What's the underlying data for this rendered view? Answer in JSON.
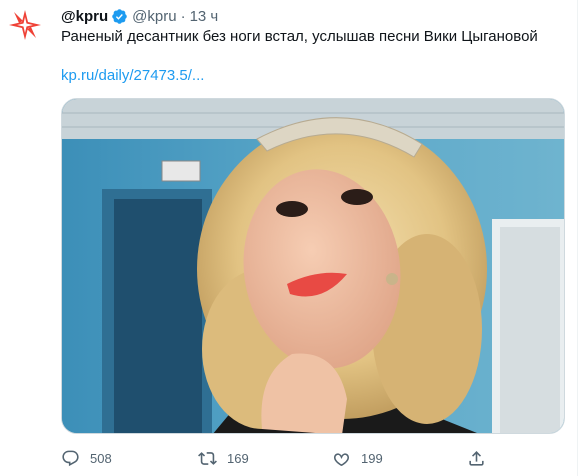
{
  "tweet": {
    "display_name": "@kpru",
    "handle": "@kpru",
    "separator": "·",
    "time": "13 ч",
    "text": "Раненый десантник без ноги встал, услышав песни Вики Цыгановой",
    "link": "kp.ru/daily/27473.5/..."
  },
  "actions": {
    "reply_count": "508",
    "retweet_count": "169",
    "like_count": "199"
  },
  "colors": {
    "brand": "#ef4136",
    "verified": "#1d9bf0",
    "link": "#1d9bf0",
    "muted": "#536471"
  },
  "icons": {
    "avatar": "kp-logo-icon",
    "verified": "verified-badge-icon",
    "reply": "reply-icon",
    "retweet": "retweet-icon",
    "like": "heart-icon",
    "share": "share-icon"
  }
}
